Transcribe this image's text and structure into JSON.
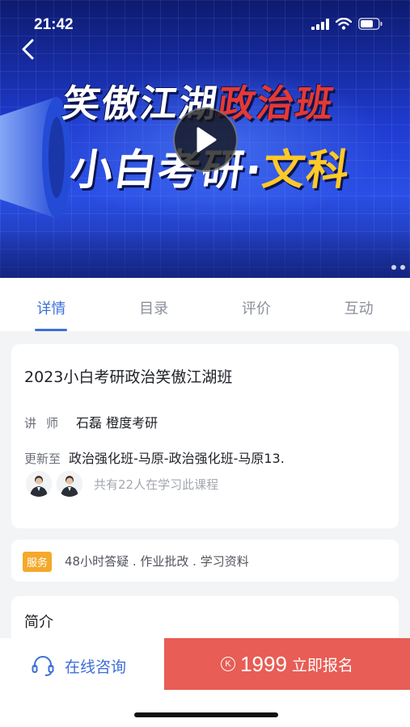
{
  "status_bar": {
    "time": "21:42"
  },
  "banner": {
    "line1_white": "笑傲江湖",
    "line1_highlight": "政治班",
    "line2_white": "小白考研·",
    "line2_highlight": "文科"
  },
  "tabs": [
    {
      "label": "详情",
      "active": true
    },
    {
      "label": "目录",
      "active": false
    },
    {
      "label": "评价",
      "active": false
    },
    {
      "label": "互动",
      "active": false
    }
  ],
  "course": {
    "title": "2023小白考研政治笑傲江湖班",
    "teacher_label": "讲师",
    "teacher_value": "石磊 橙度考研",
    "update_label": "更新至",
    "update_value": "政治强化班-马原-政治强化班-马原13.",
    "learners_text": "共有22人在学习此课程"
  },
  "service": {
    "badge": "服务",
    "text": "48小时答疑 . 作业批改 . 学习资料"
  },
  "intro": {
    "title": "简介"
  },
  "bottom_bar": {
    "consult_label": "在线咨询",
    "coin_symbol": "K",
    "price": "1999",
    "enroll_label": "立即报名"
  },
  "colors": {
    "accent": "#3d6fd8",
    "enroll": "#e85d55",
    "service_badge": "#f4a92b",
    "banner_red": "#e53935",
    "banner_yellow": "#ffc928"
  }
}
